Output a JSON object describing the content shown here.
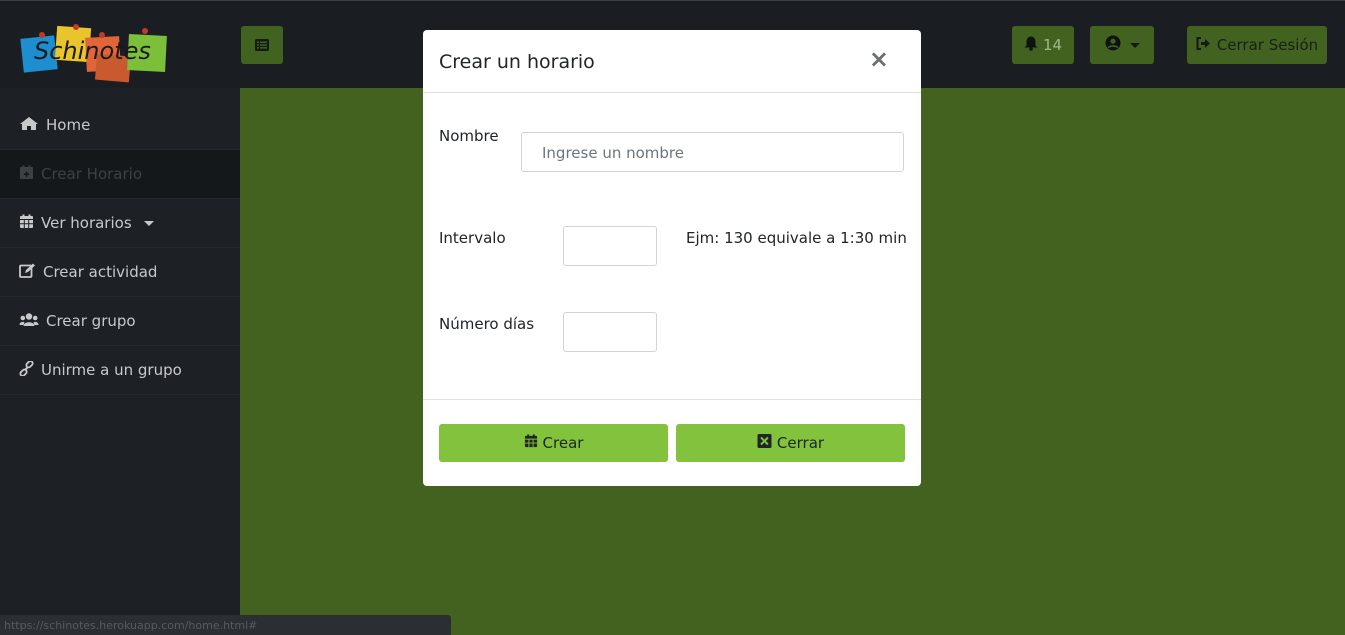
{
  "app": {
    "logo_text": "Schinotes"
  },
  "header": {
    "notification_count": "14",
    "logout_label": "Cerrar Sesión"
  },
  "sidebar": {
    "items": [
      {
        "label": "Home",
        "icon": "home-icon"
      },
      {
        "label": "Crear Horario",
        "icon": "calendar-plus-icon",
        "active": true
      },
      {
        "label": "Ver horarios",
        "icon": "calendar-icon"
      },
      {
        "label": "Crear actividad",
        "icon": "edit-icon"
      },
      {
        "label": "Crear grupo",
        "icon": "users-icon"
      },
      {
        "label": "Unirme a un grupo",
        "icon": "link-icon"
      }
    ]
  },
  "modal": {
    "title": "Crear un horario",
    "name_label": "Nombre",
    "name_placeholder": "Ingrese un nombre",
    "interval_label": "Intervalo",
    "interval_hint": "Ejm: 130 equivale a 1:30 min",
    "days_label": "Número días",
    "create_label": "Crear",
    "close_label": "Cerrar"
  },
  "statusbar": {
    "url": "https://schinotes.herokuapp.com/home.html#"
  },
  "colors": {
    "accent": "#82c23c",
    "content_bg": "#44621f",
    "sidebar_bg": "#1d2126",
    "topbar_btn": "#42621f"
  }
}
